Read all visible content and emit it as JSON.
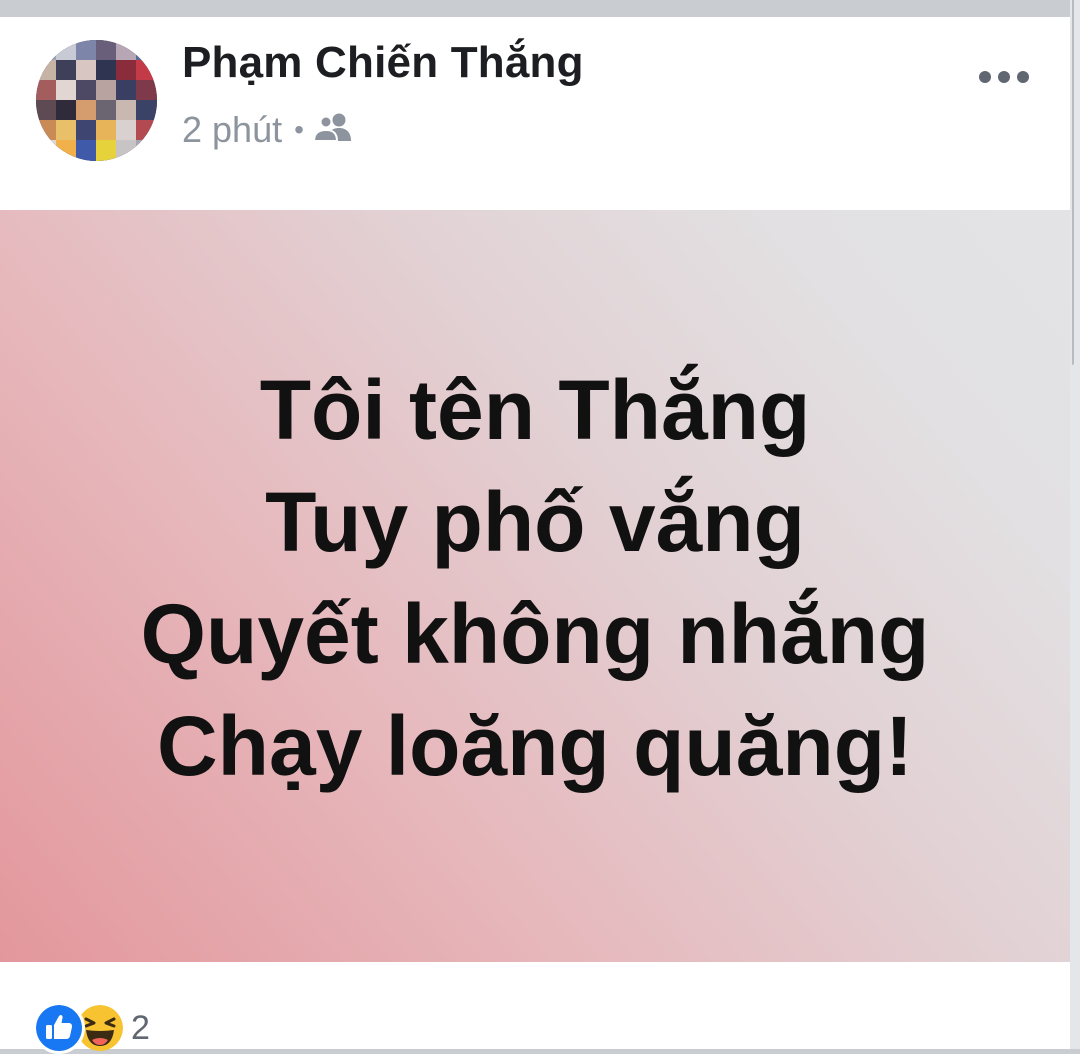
{
  "post": {
    "author_name": "Phạm Chiến Thắng",
    "timestamp": "2 phút",
    "separator": "•",
    "audience_icon": "friends-icon",
    "more_icon": "more-horizontal-icon",
    "content_lines": [
      "Tôi tên Thắng",
      "Tuy phố vắng",
      "Quyết không nhắng",
      "Chạy loăng quăng!"
    ],
    "reactions": {
      "icons": [
        "like-icon",
        "haha-icon"
      ],
      "count": "2"
    }
  },
  "colors": {
    "like_blue": "#1877f2",
    "haha_yellow": "#f7c331",
    "name_text": "#1c1e21",
    "meta_text": "#8d949e"
  }
}
